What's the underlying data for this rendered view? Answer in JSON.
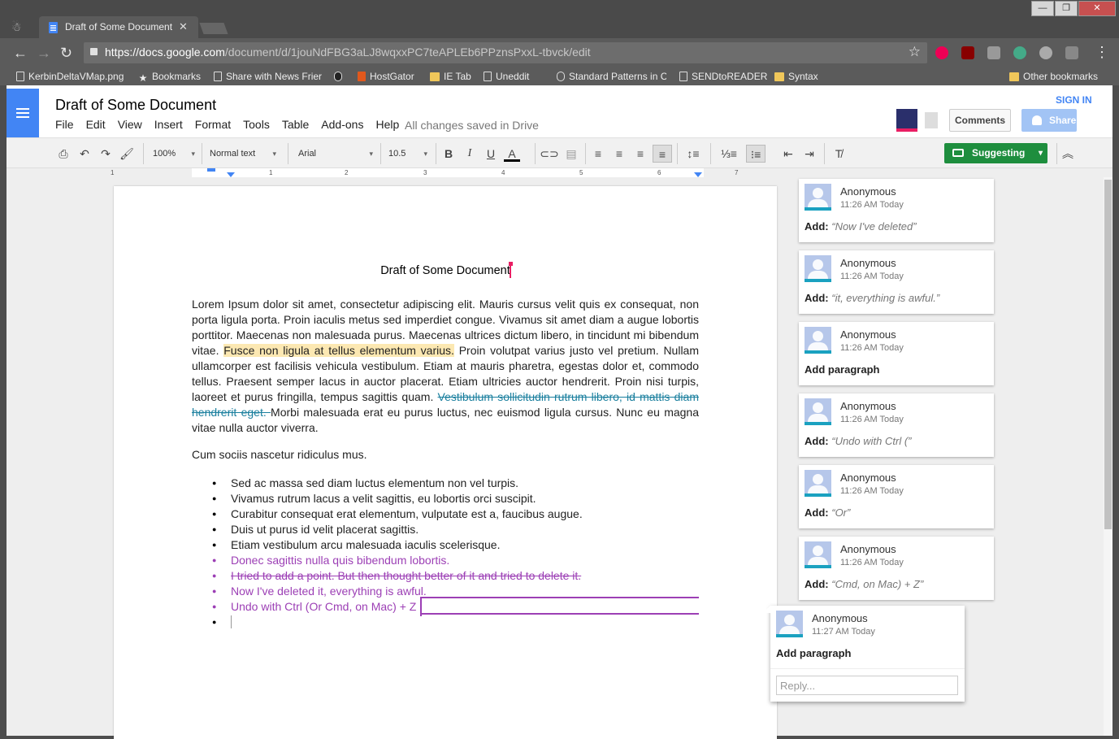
{
  "browser": {
    "tab_title": "Draft of Some Document",
    "url_host": "https://docs.google.com",
    "url_path": "/document/d/1jouNdFBG3aLJ8wqxxPC7teAPLEb6PPznsPxxL-tbvck/edit",
    "bookmarks": [
      "KerbinDeltaVMap.png",
      "Bookmarks",
      "Share with News Frier",
      "",
      "HostGator",
      "IE Tab",
      "Uneddit",
      "Standard Patterns in C",
      "SENDtoREADER",
      "Syntax"
    ],
    "other_bookmarks": "Other bookmarks"
  },
  "docs": {
    "title": "Draft of Some Document",
    "menu": [
      "File",
      "Edit",
      "View",
      "Insert",
      "Format",
      "Tools",
      "Table",
      "Add-ons",
      "Help"
    ],
    "saved_status": "All changes saved in Drive",
    "sign_in": "SIGN IN",
    "comments_btn": "Comments",
    "share_btn": "Share",
    "zoom": "100%",
    "style": "Normal text",
    "font": "Arial",
    "font_size": "10.5",
    "mode": "Suggesting",
    "ruler_numbers": [
      "1",
      "1",
      "2",
      "3",
      "4",
      "5",
      "6",
      "7"
    ]
  },
  "document": {
    "heading": "Draft of Some Document",
    "para1_a": "Lorem Ipsum dolor sit amet, consectetur adipiscing elit. Mauris cursus velit quis ex consequat, non porta ligula porta. Proin iaculis metus sed imperdiet congue. Vivamus sit amet diam a augue lobortis porttitor. Maecenas non malesuada purus. Maecenas ultrices dictum libero, in tincidunt mi bibendum vitae. ",
    "para1_highlight": "Fusce non ligula at tellus elementum varius.",
    "para1_b": " Proin volutpat varius justo vel pretium. Nullam ullamcorper est facilisis vehicula vestibulum. Etiam at mauris pharetra, egestas dolor et, commodo tellus. Praesent semper lacus in auctor placerat. Etiam ultricies auctor hendrerit. Proin nisi turpis, laoreet et purus fringilla, tempus sagittis quam. ",
    "para1_deleted": "Vestibulum sollicitudin rutrum libero, id mattis diam hendrerit eget. ",
    "para1_c": "Morbi malesuada erat eu purus luctus, nec euismod ligula cursus. Nunc eu magna vitae nulla auctor viverra.",
    "para2": "Cum sociis nascetur ridiculus mus.",
    "list": [
      "Sed ac massa sed diam luctus elementum non vel turpis.",
      "Vivamus rutrum lacus a velit sagittis, eu lobortis orci suscipit.",
      "Curabitur consequat erat elementum, vulputate est a, faucibus augue.",
      "Duis ut purus id velit placerat sagittis.",
      "Etiam vestibulum arcu malesuada iaculis scelerisque.",
      "Donec sagittis nulla quis bibendum lobortis.",
      "I tried to add a point. But then thought better of it and tried to delete it.",
      "Now I've deleted it, everything is awful.",
      "Undo with Ctrl (Or Cmd, on Mac) + Z"
    ]
  },
  "comments": [
    {
      "name": "Anonymous",
      "time": "11:26 AM Today",
      "action": "Add:",
      "text": "“Now I've deleted”"
    },
    {
      "name": "Anonymous",
      "time": "11:26 AM Today",
      "action": "Add:",
      "text": "“it, everything is awful.”"
    },
    {
      "name": "Anonymous",
      "time": "11:26 AM Today",
      "action": "Add paragraph",
      "text": ""
    },
    {
      "name": "Anonymous",
      "time": "11:26 AM Today",
      "action": "Add:",
      "text": "“Undo with Ctrl (”"
    },
    {
      "name": "Anonymous",
      "time": "11:26 AM Today",
      "action": "Add:",
      "text": "“Or”"
    },
    {
      "name": "Anonymous",
      "time": "11:26 AM Today",
      "action": "Add:",
      "text": "“Cmd, on Mac) + Z”"
    }
  ],
  "active_comment": {
    "name": "Anonymous",
    "time": "11:27 AM Today",
    "action": "Add paragraph",
    "reply_placeholder": "Reply..."
  },
  "colors": {
    "accent": "#4285f4",
    "suggest_green": "#1e8e3e",
    "suggest_purple": "#9c3fb5",
    "highlight": "#fce8b2"
  }
}
